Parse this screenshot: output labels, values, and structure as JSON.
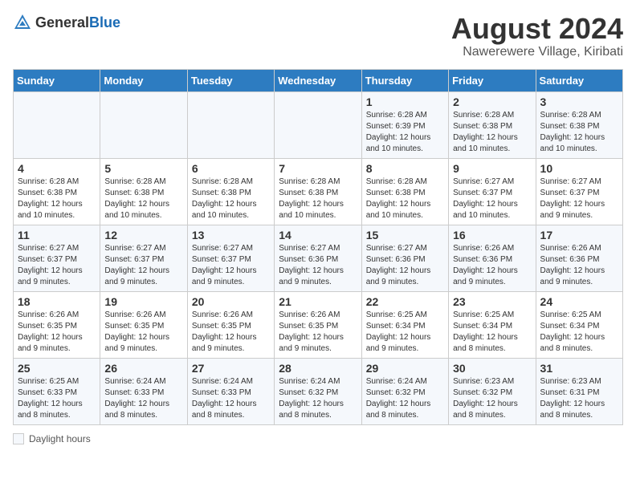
{
  "header": {
    "logo_general": "General",
    "logo_blue": "Blue",
    "title": "August 2024",
    "subtitle": "Nawerewere Village, Kiribati"
  },
  "columns": [
    "Sunday",
    "Monday",
    "Tuesday",
    "Wednesday",
    "Thursday",
    "Friday",
    "Saturday"
  ],
  "weeks": [
    [
      {
        "day": "",
        "info": ""
      },
      {
        "day": "",
        "info": ""
      },
      {
        "day": "",
        "info": ""
      },
      {
        "day": "",
        "info": ""
      },
      {
        "day": "1",
        "info": "Sunrise: 6:28 AM\nSunset: 6:39 PM\nDaylight: 12 hours and 10 minutes."
      },
      {
        "day": "2",
        "info": "Sunrise: 6:28 AM\nSunset: 6:38 PM\nDaylight: 12 hours and 10 minutes."
      },
      {
        "day": "3",
        "info": "Sunrise: 6:28 AM\nSunset: 6:38 PM\nDaylight: 12 hours and 10 minutes."
      }
    ],
    [
      {
        "day": "4",
        "info": "Sunrise: 6:28 AM\nSunset: 6:38 PM\nDaylight: 12 hours and 10 minutes."
      },
      {
        "day": "5",
        "info": "Sunrise: 6:28 AM\nSunset: 6:38 PM\nDaylight: 12 hours and 10 minutes."
      },
      {
        "day": "6",
        "info": "Sunrise: 6:28 AM\nSunset: 6:38 PM\nDaylight: 12 hours and 10 minutes."
      },
      {
        "day": "7",
        "info": "Sunrise: 6:28 AM\nSunset: 6:38 PM\nDaylight: 12 hours and 10 minutes."
      },
      {
        "day": "8",
        "info": "Sunrise: 6:28 AM\nSunset: 6:38 PM\nDaylight: 12 hours and 10 minutes."
      },
      {
        "day": "9",
        "info": "Sunrise: 6:27 AM\nSunset: 6:37 PM\nDaylight: 12 hours and 10 minutes."
      },
      {
        "day": "10",
        "info": "Sunrise: 6:27 AM\nSunset: 6:37 PM\nDaylight: 12 hours and 9 minutes."
      }
    ],
    [
      {
        "day": "11",
        "info": "Sunrise: 6:27 AM\nSunset: 6:37 PM\nDaylight: 12 hours and 9 minutes."
      },
      {
        "day": "12",
        "info": "Sunrise: 6:27 AM\nSunset: 6:37 PM\nDaylight: 12 hours and 9 minutes."
      },
      {
        "day": "13",
        "info": "Sunrise: 6:27 AM\nSunset: 6:37 PM\nDaylight: 12 hours and 9 minutes."
      },
      {
        "day": "14",
        "info": "Sunrise: 6:27 AM\nSunset: 6:36 PM\nDaylight: 12 hours and 9 minutes."
      },
      {
        "day": "15",
        "info": "Sunrise: 6:27 AM\nSunset: 6:36 PM\nDaylight: 12 hours and 9 minutes."
      },
      {
        "day": "16",
        "info": "Sunrise: 6:26 AM\nSunset: 6:36 PM\nDaylight: 12 hours and 9 minutes."
      },
      {
        "day": "17",
        "info": "Sunrise: 6:26 AM\nSunset: 6:36 PM\nDaylight: 12 hours and 9 minutes."
      }
    ],
    [
      {
        "day": "18",
        "info": "Sunrise: 6:26 AM\nSunset: 6:35 PM\nDaylight: 12 hours and 9 minutes."
      },
      {
        "day": "19",
        "info": "Sunrise: 6:26 AM\nSunset: 6:35 PM\nDaylight: 12 hours and 9 minutes."
      },
      {
        "day": "20",
        "info": "Sunrise: 6:26 AM\nSunset: 6:35 PM\nDaylight: 12 hours and 9 minutes."
      },
      {
        "day": "21",
        "info": "Sunrise: 6:26 AM\nSunset: 6:35 PM\nDaylight: 12 hours and 9 minutes."
      },
      {
        "day": "22",
        "info": "Sunrise: 6:25 AM\nSunset: 6:34 PM\nDaylight: 12 hours and 9 minutes."
      },
      {
        "day": "23",
        "info": "Sunrise: 6:25 AM\nSunset: 6:34 PM\nDaylight: 12 hours and 8 minutes."
      },
      {
        "day": "24",
        "info": "Sunrise: 6:25 AM\nSunset: 6:34 PM\nDaylight: 12 hours and 8 minutes."
      }
    ],
    [
      {
        "day": "25",
        "info": "Sunrise: 6:25 AM\nSunset: 6:33 PM\nDaylight: 12 hours and 8 minutes."
      },
      {
        "day": "26",
        "info": "Sunrise: 6:24 AM\nSunset: 6:33 PM\nDaylight: 12 hours and 8 minutes."
      },
      {
        "day": "27",
        "info": "Sunrise: 6:24 AM\nSunset: 6:33 PM\nDaylight: 12 hours and 8 minutes."
      },
      {
        "day": "28",
        "info": "Sunrise: 6:24 AM\nSunset: 6:32 PM\nDaylight: 12 hours and 8 minutes."
      },
      {
        "day": "29",
        "info": "Sunrise: 6:24 AM\nSunset: 6:32 PM\nDaylight: 12 hours and 8 minutes."
      },
      {
        "day": "30",
        "info": "Sunrise: 6:23 AM\nSunset: 6:32 PM\nDaylight: 12 hours and 8 minutes."
      },
      {
        "day": "31",
        "info": "Sunrise: 6:23 AM\nSunset: 6:31 PM\nDaylight: 12 hours and 8 minutes."
      }
    ]
  ],
  "legend": {
    "box_label": "Daylight hours"
  }
}
